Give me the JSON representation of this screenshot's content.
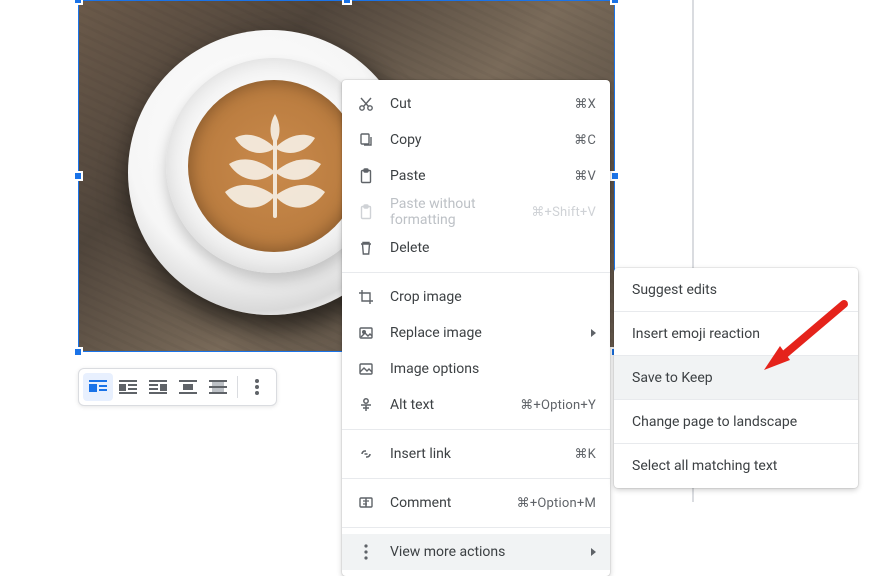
{
  "image_toolbar": {
    "buttons": [
      {
        "name": "wrap-inline",
        "active": true
      },
      {
        "name": "wrap-text-left"
      },
      {
        "name": "wrap-text-right"
      },
      {
        "name": "break-text"
      },
      {
        "name": "behind-text"
      }
    ],
    "more": "more-options"
  },
  "context_menu": {
    "groups": [
      [
        {
          "icon": "cut-icon",
          "label": "Cut",
          "shortcut": "⌘X"
        },
        {
          "icon": "copy-icon",
          "label": "Copy",
          "shortcut": "⌘C"
        },
        {
          "icon": "paste-icon",
          "label": "Paste",
          "shortcut": "⌘V"
        },
        {
          "icon": "paste-plain-icon",
          "label": "Paste without formatting",
          "shortcut": "⌘+Shift+V",
          "disabled": true
        },
        {
          "icon": "delete-icon",
          "label": "Delete"
        }
      ],
      [
        {
          "icon": "crop-icon",
          "label": "Crop image"
        },
        {
          "icon": "replace-image-icon",
          "label": "Replace image",
          "submenu": true
        },
        {
          "icon": "image-options-icon",
          "label": "Image options"
        },
        {
          "icon": "alt-text-icon",
          "label": "Alt text",
          "shortcut": "⌘+Option+Y"
        }
      ],
      [
        {
          "icon": "link-icon",
          "label": "Insert link",
          "shortcut": "⌘K"
        }
      ],
      [
        {
          "icon": "comment-icon",
          "label": "Comment",
          "shortcut": "⌘+Option+M"
        }
      ],
      [
        {
          "icon": "more-vert-icon",
          "label": "View more actions",
          "submenu": true,
          "hover": true
        }
      ]
    ]
  },
  "submenu": {
    "items": [
      {
        "label": "Suggest edits"
      },
      {
        "label": "Insert emoji reaction"
      },
      {
        "label": "Save to Keep",
        "hover": true
      },
      {
        "label": "Change page to landscape"
      },
      {
        "label": "Select all matching text"
      }
    ]
  },
  "colors": {
    "selection": "#1a73e8",
    "annotation_arrow": "#e5231b"
  }
}
